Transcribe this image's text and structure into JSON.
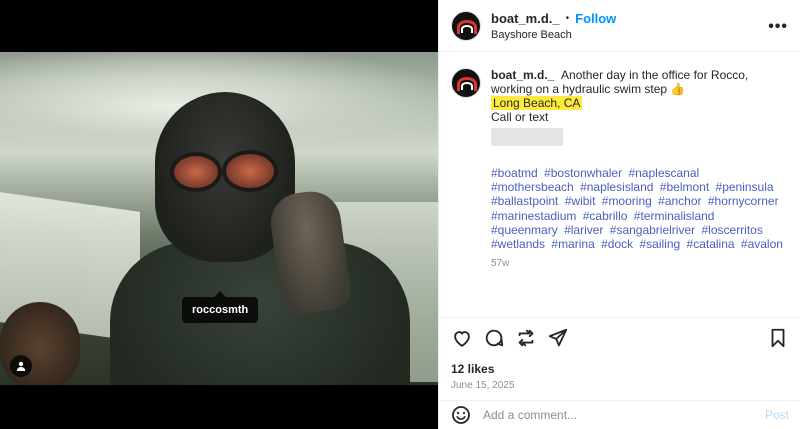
{
  "post": {
    "username": "boat_m.d._",
    "dot": "•",
    "follow_label": "Follow",
    "location": "Bayshore Beach",
    "more_label": "•••"
  },
  "media": {
    "user_tag": "roccosmth"
  },
  "caption": {
    "username": "boat_m.d._",
    "text": "Another day in the office for Rocco, working on a hydraulic swim step 👍",
    "location_highlight": "Long Beach, CA",
    "call_text": "Call or text",
    "hashtags": [
      "#boatmd",
      "#bostonwhaler",
      "#naplescanal",
      "#mothersbeach",
      "#naplesisland",
      "#belmont",
      "#peninsula",
      "#ballastpoint",
      "#wibit",
      "#mooring",
      "#anchor",
      "#hornycorner",
      "#marinestadium",
      "#cabrillo",
      "#terminalisland",
      "#queenmary",
      "#lariver",
      "#sangabrielriver",
      "#loscerritos",
      "#wetlands",
      "#marina",
      "#dock",
      "#sailing",
      "#catalina",
      "#avalon"
    ],
    "time": "57w"
  },
  "stats": {
    "likes": "12 likes",
    "date": "June 15, 2025"
  },
  "composer": {
    "placeholder": "Add a comment...",
    "post_label": "Post"
  },
  "icons": {
    "like": "heart-icon",
    "comment": "comment-icon",
    "repost": "repost-icon",
    "share": "share-icon",
    "save": "bookmark-icon",
    "emoji": "emoji-icon",
    "tag": "user-tag-icon",
    "more": "more-options-icon"
  },
  "colors": {
    "follow": "#0095f6",
    "hashtag": "#4a5fc1",
    "highlight": "#ffeb3b",
    "post_disabled": "#b3dbff"
  }
}
